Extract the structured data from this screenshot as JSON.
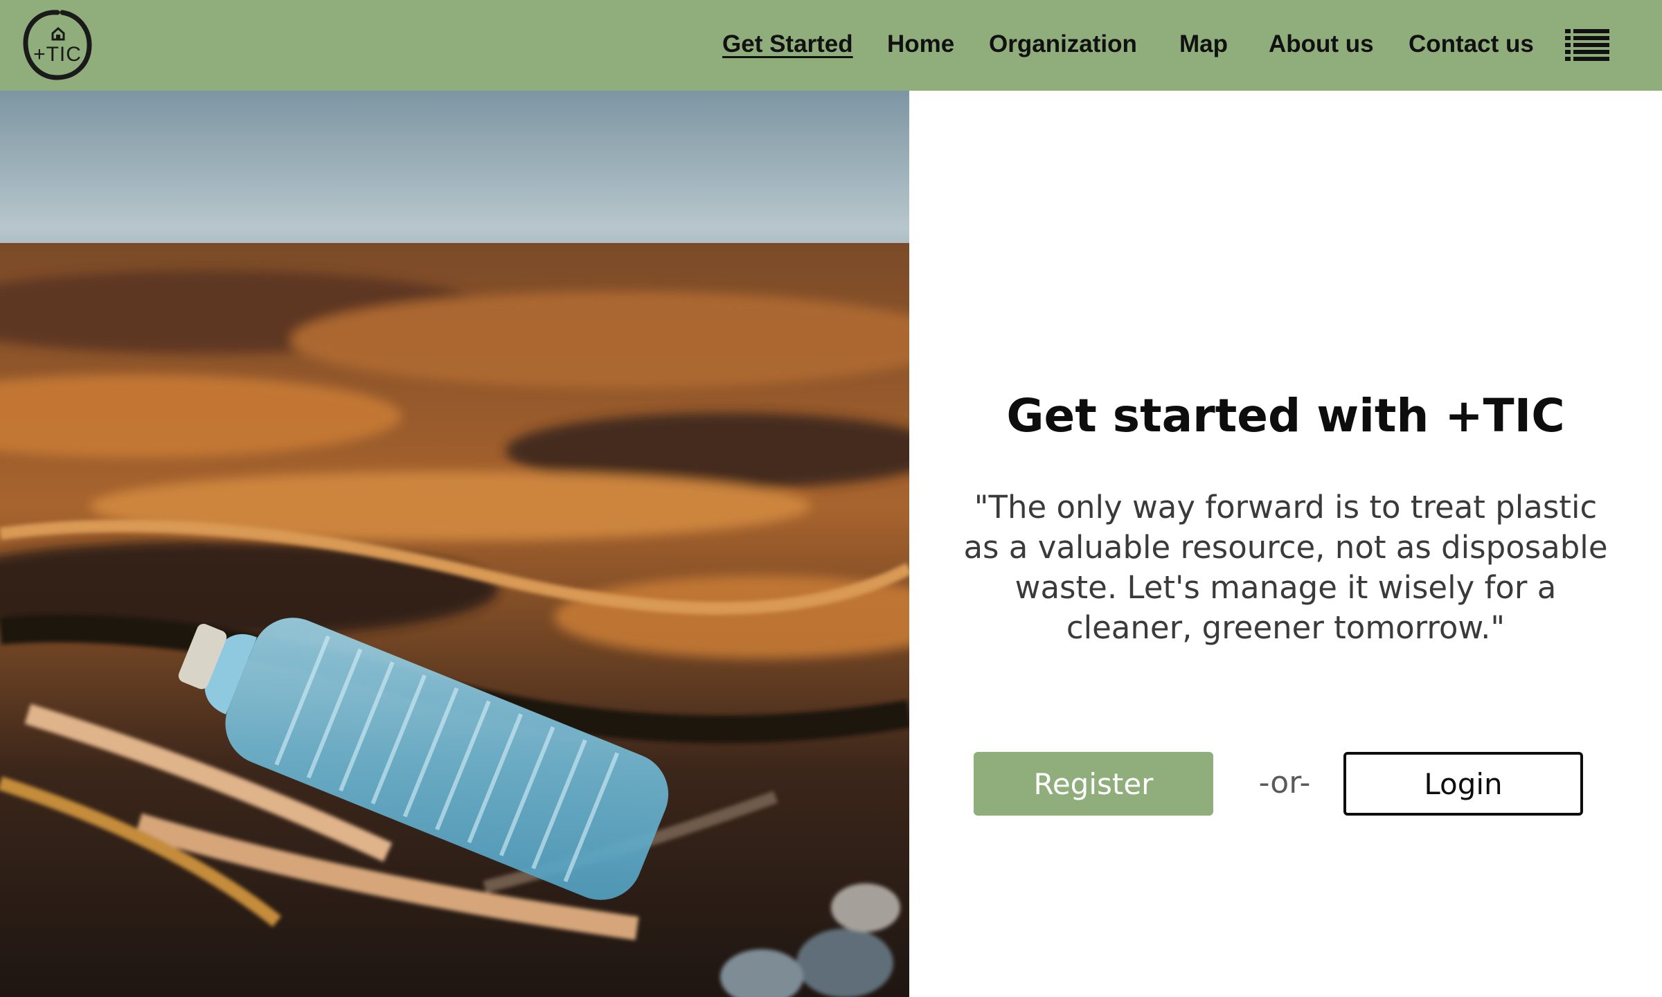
{
  "brand": {
    "logo_text": "+TIC",
    "accent_color": "#8fae7b"
  },
  "nav": {
    "items": [
      {
        "label": "Get Started",
        "active": true
      },
      {
        "label": "Home",
        "active": false
      },
      {
        "label": "Organization",
        "active": false
      },
      {
        "label": "Map",
        "active": false
      },
      {
        "label": "About us",
        "active": false
      },
      {
        "label": "Contact us",
        "active": false
      }
    ],
    "menu_icon": "list-menu-icon"
  },
  "hero": {
    "image_subject": "plastic bottle on seaweed-covered beach"
  },
  "panel": {
    "headline": "Get started with +TIC",
    "quote": "\"The only way forward is to treat plastic as a valuable resource, not as disposable waste. Let's manage it wisely for a cleaner, greener tomorrow.\"",
    "register_label": "Register",
    "separator": "-or-",
    "login_label": "Login"
  }
}
